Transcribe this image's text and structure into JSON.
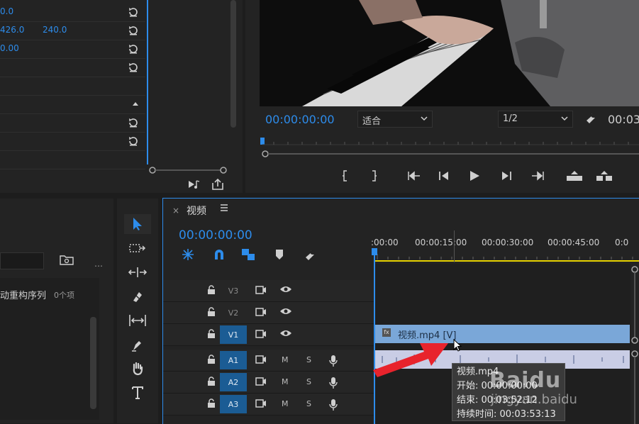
{
  "effect_controls": {
    "rows": [
      {
        "value_a": "0.0",
        "value_b": ""
      },
      {
        "value_a": "426.0",
        "value_b": "240.0"
      },
      {
        "value_a": "0.00",
        "value_b": ""
      },
      {
        "value_a": "",
        "value_b": ""
      }
    ]
  },
  "program": {
    "timecode": "00:00:00:00",
    "fit": "适合",
    "resolution": "1/2",
    "duration_partial": "00:03"
  },
  "project": {
    "item_label": "动重构序列",
    "item_count": "0个项"
  },
  "timeline": {
    "tab_title": "视频",
    "timecode": "00:00:00:00",
    "ruler": [
      ":00:00",
      "00:00:15:00",
      "00:00:30:00",
      "00:00:45:00",
      "0:0"
    ],
    "tracks": [
      {
        "name": "V3",
        "type": "video"
      },
      {
        "name": "V2",
        "type": "video"
      },
      {
        "name": "V1",
        "type": "video"
      },
      {
        "name": "A1",
        "type": "audio"
      },
      {
        "name": "A2",
        "type": "audio"
      },
      {
        "name": "A3",
        "type": "audio"
      }
    ],
    "mute_label": "M",
    "solo_label": "S",
    "clip_label": "视频.mp4 [V]",
    "clip_fx": "fx"
  },
  "tooltip": {
    "name": "视频.mp4",
    "start": "开始: 00:00:00:00",
    "end": "结束: 00:03:52:12",
    "duration": "持续时间: 00:03:53:13"
  },
  "watermark": {
    "brand": "Baidu",
    "site": "jingyan.baidu"
  },
  "colors": {
    "accent": "#2d8ceb",
    "track_active": "#1b5c94",
    "clip_video": "#7aa7d8",
    "arrow": "#e8232c",
    "playhead_bar": "#e6d200"
  }
}
